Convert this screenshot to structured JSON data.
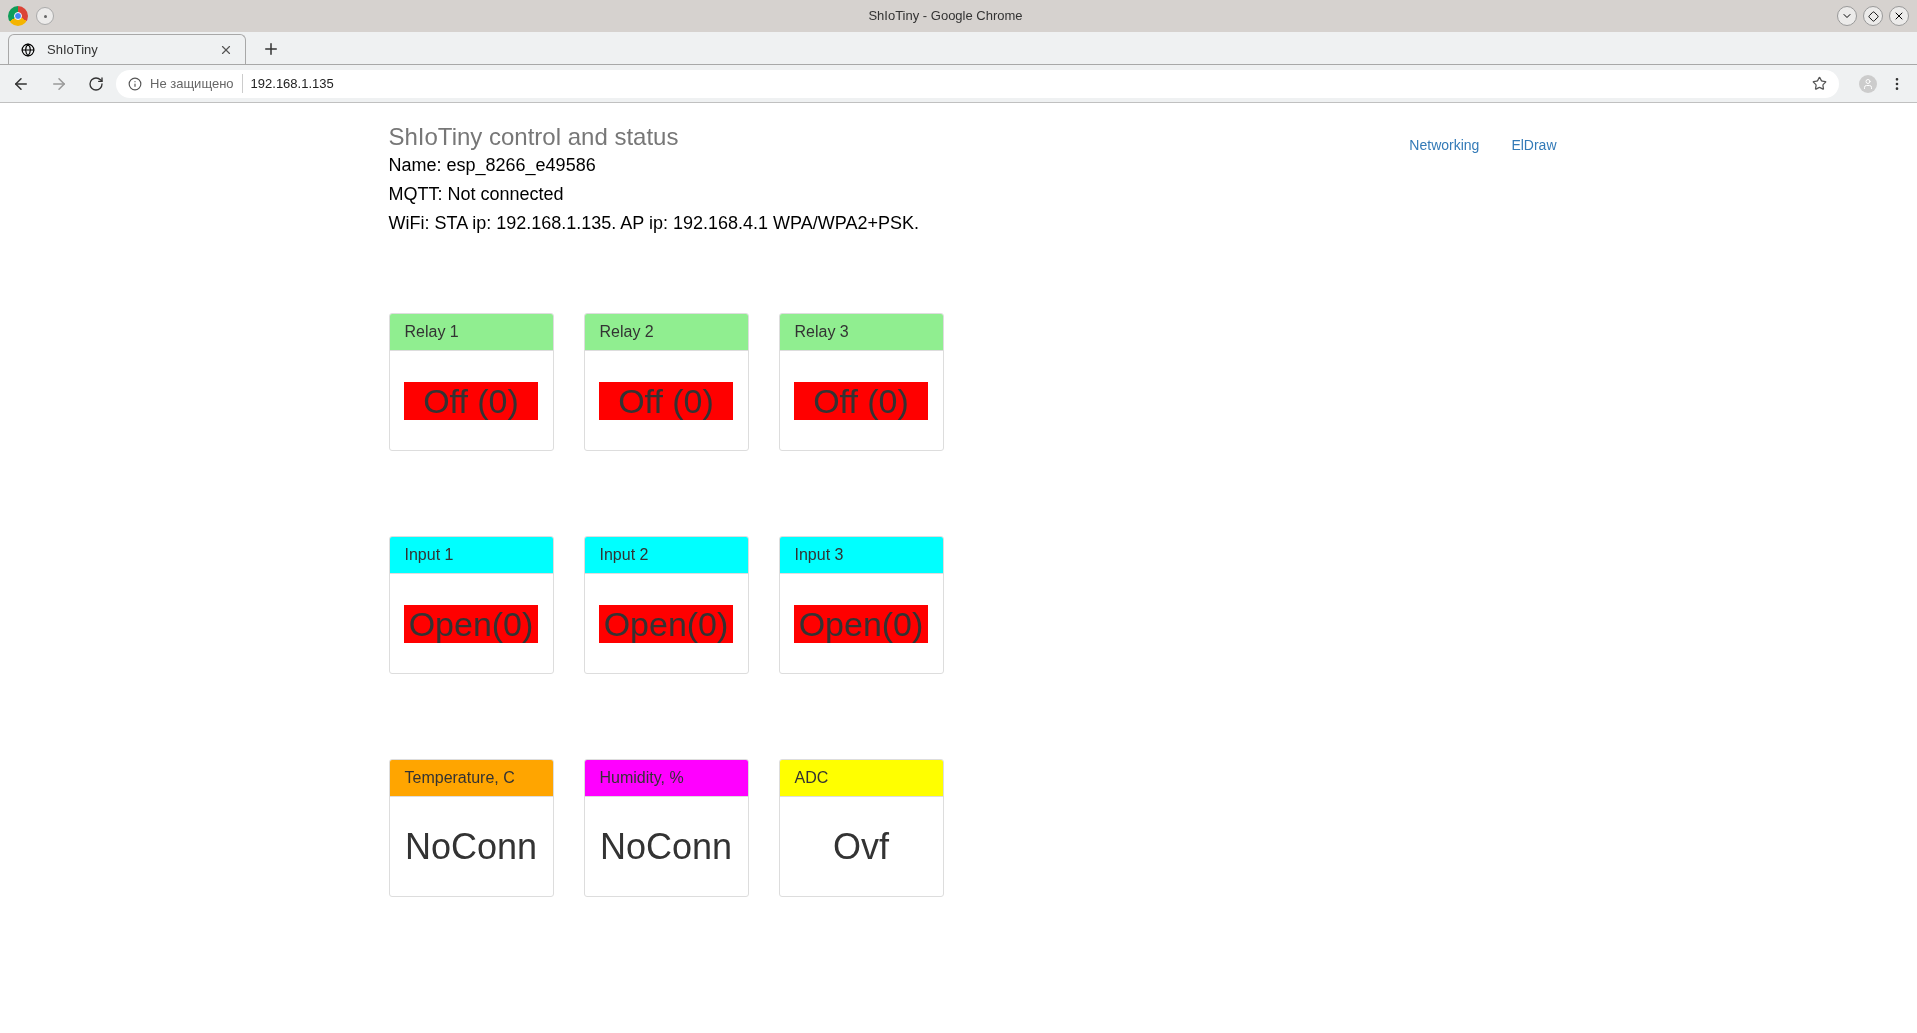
{
  "window": {
    "title": "ShIoTiny - Google Chrome"
  },
  "tabs": [
    {
      "label": "ShIoTiny",
      "selected": true
    }
  ],
  "address_bar": {
    "security": "Не защищено",
    "url": "192.168.1.135"
  },
  "header": {
    "title": "ShIoTiny control and status",
    "lines": [
      "Name: esp_8266_e49586",
      "MQTT: Not connected",
      "WiFi: STA ip: 192.168.1.135. AP ip: 192.168.4.1 WPA/WPA2+PSK."
    ]
  },
  "nav_links": [
    "Networking",
    "ElDraw"
  ],
  "card_rows": [
    [
      {
        "title": "Relay 1",
        "color": "#90ee90",
        "value": "Off (0)",
        "on": false
      },
      {
        "title": "Relay 2",
        "color": "#90ee90",
        "value": "Off (0)",
        "on": false
      },
      {
        "title": "Relay 3",
        "color": "#90ee90",
        "value": "Off (0)",
        "on": false
      }
    ],
    [
      {
        "title": "Input 1",
        "color": "#00ffff",
        "value": "Open(0)",
        "on": false
      },
      {
        "title": "Input 2",
        "color": "#00ffff",
        "value": "Open(0)",
        "on": false
      },
      {
        "title": "Input 3",
        "color": "#00ffff",
        "value": "Open(0)",
        "on": false
      }
    ],
    [
      {
        "title": "Temperature, C",
        "color": "#ffa500",
        "value": "NoConn"
      },
      {
        "title": "Humidity, %",
        "color": "#ff00ff",
        "value": "NoConn"
      },
      {
        "title": "ADC",
        "color": "#ffff00",
        "value": "Ovf"
      }
    ]
  ]
}
